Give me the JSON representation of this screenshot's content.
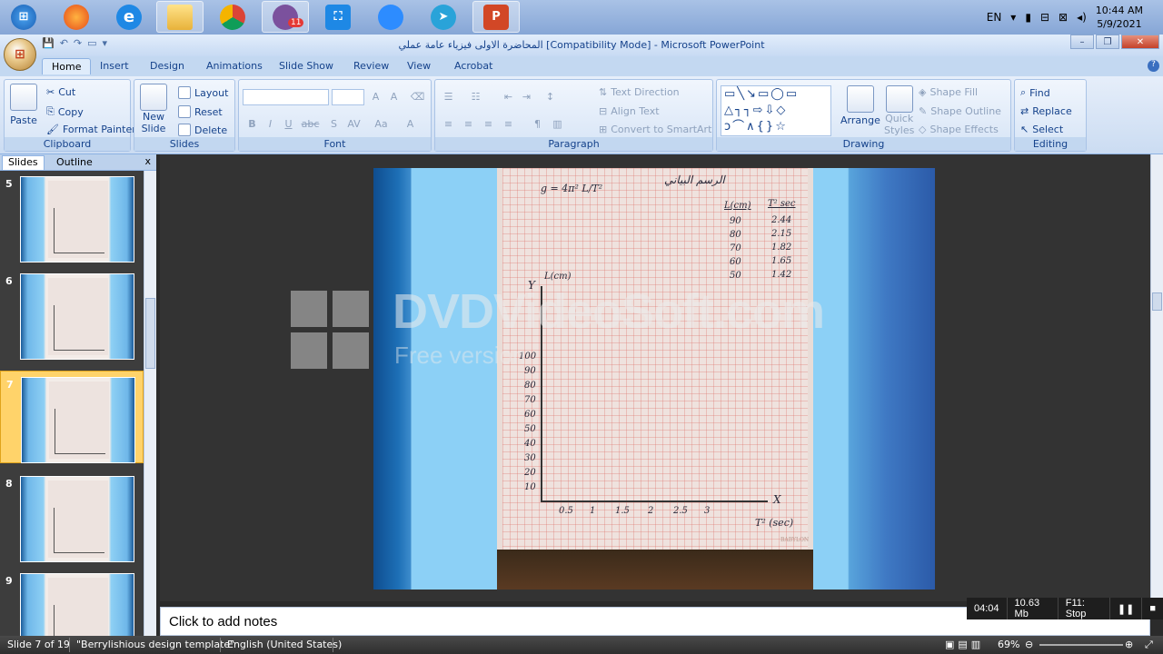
{
  "taskbar": {
    "apps": [
      {
        "name": "start",
        "label": ""
      },
      {
        "name": "firefox",
        "label": ""
      },
      {
        "name": "ie",
        "label": ""
      },
      {
        "name": "explorer",
        "label": ""
      },
      {
        "name": "chrome",
        "label": ""
      },
      {
        "name": "viber",
        "label": "",
        "badge": "11"
      },
      {
        "name": "screenshot",
        "label": ""
      },
      {
        "name": "zoom",
        "label": ""
      },
      {
        "name": "telegram",
        "label": ""
      },
      {
        "name": "powerpoint",
        "label": ""
      }
    ],
    "lang": "EN",
    "time": "10:44 AM",
    "date": "5/9/2021"
  },
  "window": {
    "title": "المحاضرة الاولى فيزياء عامة عملي [Compatibility Mode] - Microsoft PowerPoint"
  },
  "ribbon": {
    "tabs": [
      "Home",
      "Insert",
      "Design",
      "Animations",
      "Slide Show",
      "Review",
      "View",
      "Acrobat"
    ],
    "clipboard": {
      "label": "Clipboard",
      "paste": "Paste",
      "cut": "Cut",
      "copy": "Copy",
      "format_painter": "Format Painter"
    },
    "slides": {
      "label": "Slides",
      "new_slide": "New",
      "new_slide2": "Slide",
      "layout": "Layout",
      "reset": "Reset",
      "delete": "Delete"
    },
    "font": {
      "label": "Font"
    },
    "paragraph": {
      "label": "Paragraph",
      "text_direction": "Text Direction",
      "align_text": "Align Text",
      "convert": "Convert to SmartArt"
    },
    "drawing": {
      "label": "Drawing",
      "arrange": "Arrange",
      "quick": "Quick",
      "styles": "Styles",
      "shape_fill": "Shape Fill",
      "shape_outline": "Shape Outline",
      "shape_effects": "Shape Effects"
    },
    "editing": {
      "label": "Editing",
      "find": "Find",
      "replace": "Replace",
      "select": "Select"
    }
  },
  "left_pane": {
    "tabs": [
      "Slides",
      "Outline"
    ],
    "close": "x",
    "slides": [
      "5",
      "6",
      "7",
      "8",
      "9"
    ],
    "active": "7"
  },
  "slide": {
    "formula": "g = 4π²  L/T²",
    "heading": "الرسم البياني",
    "col_l": "L(cm)",
    "col_t": "T² sec",
    "rows": [
      [
        "90",
        "2.44"
      ],
      [
        "80",
        "2.15"
      ],
      [
        "70",
        "1.82"
      ],
      [
        "60",
        "1.65"
      ],
      [
        "50",
        "1.42"
      ]
    ],
    "y_axis_label": "L(cm)",
    "y_letter": "Y",
    "x_letter": "X",
    "y_ticks": [
      "100",
      "90",
      "80",
      "70",
      "60",
      "50",
      "40",
      "30",
      "20",
      "10"
    ],
    "x_ticks": [
      "0.5",
      "1",
      "1.5",
      "2",
      "2.5",
      "3"
    ],
    "x_axis_label": "T² (sec)",
    "paper_brand": "BABYLON"
  },
  "watermark": {
    "text": "DVDVideoSoft.com",
    "sub": "Free version"
  },
  "notes": {
    "placeholder": "Click to add notes"
  },
  "recorder": {
    "time": "04:04",
    "size": "10.63 Mb",
    "stop": "F11: Stop"
  },
  "status": {
    "slide": "Slide 7 of 19",
    "theme": "\"Berrylishious design template\"",
    "language": "English (United States)",
    "zoom": "69%"
  }
}
